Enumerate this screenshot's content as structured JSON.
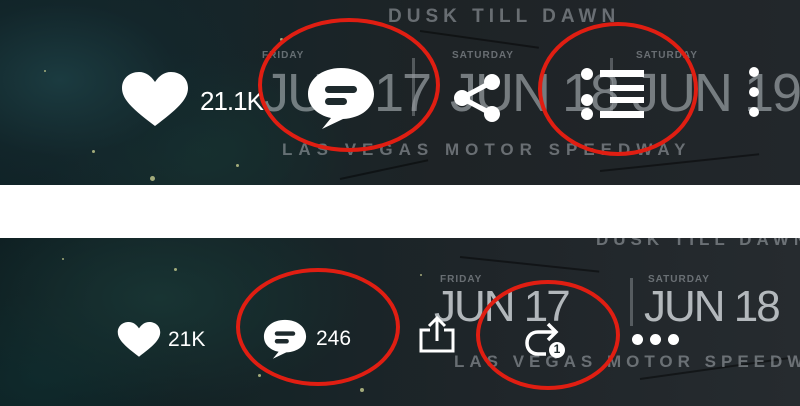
{
  "top_panel": {
    "poster": {
      "headline": "DUSK TILL DAWN",
      "day_friday": "FRIDAY",
      "day_saturday_1": "SATURDAY",
      "day_saturday_2": "SATURDAY",
      "date_1": "JUN 17",
      "date_2": "JUN 18",
      "date_3": "JUN 19",
      "venue": "LAS VEGAS MOTOR SPEEDWAY"
    },
    "actions": {
      "like_count": "21.1K"
    },
    "icons": [
      "heart-icon",
      "comment-bubble-icon",
      "share-icon",
      "list-icon",
      "more-vertical-icon"
    ]
  },
  "bottom_panel": {
    "poster": {
      "headline": "DUSK TILL DAWN",
      "day_friday": "FRIDAY",
      "day_saturday": "SATURDAY",
      "date_1": "JUN 17",
      "date_2": "JUN 18",
      "venue": "LAS VEGAS MOTOR SPEEDWAY"
    },
    "actions": {
      "like_count": "21K",
      "comment_count": "246",
      "repost_badge": "1"
    },
    "icons": [
      "heart-icon",
      "comment-bubble-icon",
      "upload-share-icon",
      "repost-icon",
      "more-horizontal-icon"
    ]
  },
  "highlight_color": "#e01e12"
}
